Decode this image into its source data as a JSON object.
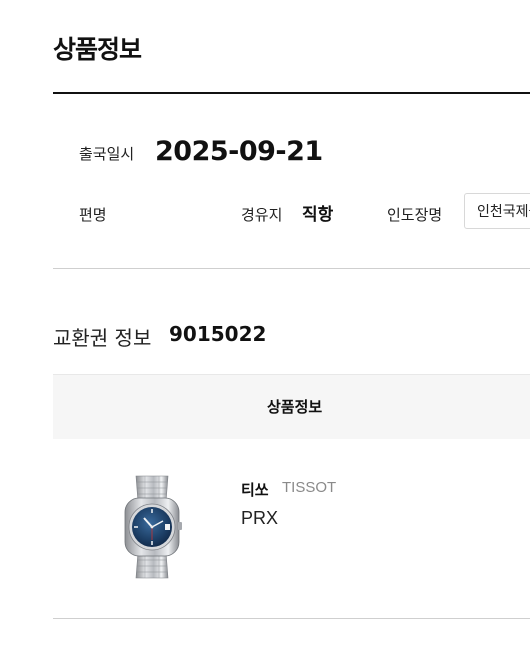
{
  "page": {
    "title": "상품정보"
  },
  "departure": {
    "label": "출국일시",
    "value": "2025-09-21"
  },
  "flight": {
    "label": "편명",
    "value": ""
  },
  "route": {
    "label": "경유지",
    "value": "직항"
  },
  "pickup": {
    "label": "인도장명",
    "value": "인천국제공항"
  },
  "voucher": {
    "label": "교환권 정보",
    "number": "9015022"
  },
  "table": {
    "header": "상품정보"
  },
  "product": {
    "brand_kr": "티쏘",
    "brand_en": "TISSOT",
    "model": "PRX",
    "image_icon": "watch-image"
  }
}
